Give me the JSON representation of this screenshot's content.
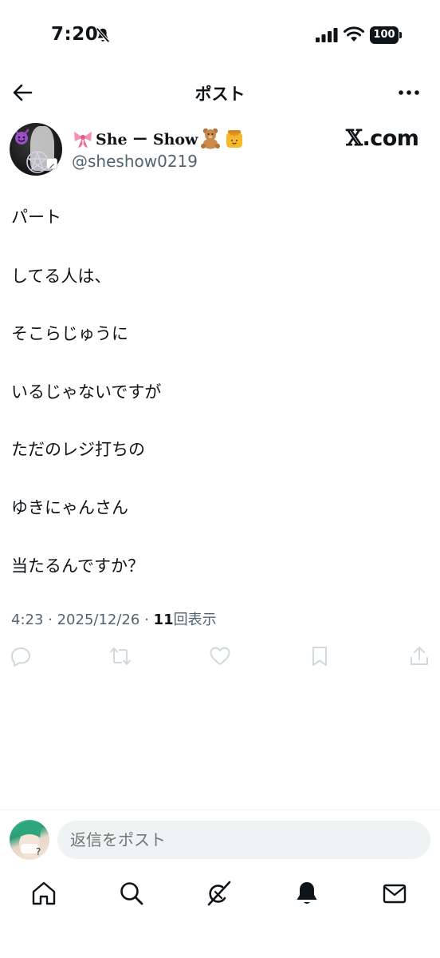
{
  "status_bar": {
    "time": "7:20",
    "battery": "100",
    "icons": [
      "bell-slash-icon",
      "signal-icon",
      "wifi-icon",
      "battery-icon"
    ]
  },
  "nav": {
    "title": "ポスト",
    "back_icon": "arrow-left-icon",
    "more_icon": "more-horizontal-icon"
  },
  "author": {
    "display_name": "She ー Show",
    "name_emojis": [
      "ribbon-emoji",
      "teddy-bear-emoji",
      "honey-pot-emoji"
    ],
    "handle": "@sheshow0219",
    "source_label_x": "𝕏",
    "source_label_rest": ".com"
  },
  "tweet": {
    "lines": [
      "パート",
      "してる人は、",
      "そこらじゅうに",
      "いるじゃないですが",
      "ただのレジ打ちの",
      "ゆきにゃんさん",
      "当たるんですか？"
    ]
  },
  "meta": {
    "time": "4:23",
    "date": "2025/12/26",
    "views_count": "11",
    "views_label": "回表示"
  },
  "actions": [
    "reply-icon",
    "retweet-icon",
    "like-icon",
    "bookmark-icon",
    "share-icon"
  ],
  "reply": {
    "placeholder": "返信をポスト"
  },
  "tab_bar": [
    "home-icon",
    "search-icon",
    "grok-icon",
    "notifications-icon",
    "messages-icon"
  ],
  "colors": {
    "text": "#0f1419",
    "secondary": "#536471",
    "action_icon": "#cfd9de",
    "input_bg": "#eff3f4"
  }
}
